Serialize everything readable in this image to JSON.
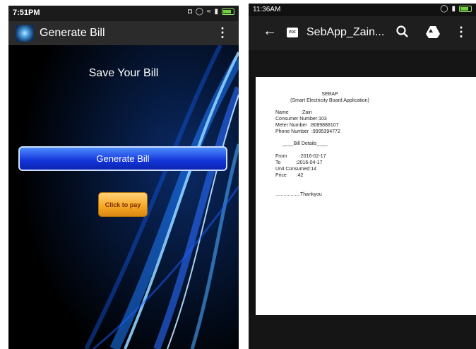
{
  "left": {
    "status_time": "7:51PM",
    "app_title": "Generate Bill",
    "heading": "Save Your Bill",
    "generate_button": "Generate Bill",
    "pay_button": "Click to pay"
  },
  "right": {
    "status_time": "11:36AM",
    "pdf_badge": "PDF",
    "file_title": "SebApp_Zain...",
    "document": {
      "title": "SEBAP",
      "subtitle": "(Smart Electricity Board Application)",
      "name": "Name         :Zain",
      "consumer": "Consumer Number:103",
      "meter": "Meter Number  :8089888107",
      "phone": "Phone Number  :9995394772",
      "bill_details": "____Bill Details____",
      "from": "From         :2016-02-17",
      "to": "To           :2016-04-17",
      "units": "Unit Consumed:14",
      "price": "Price       :42",
      "thanks": "..................Thankyou"
    }
  },
  "colors": {
    "generate_button": "#1334d8",
    "pay_button": "#f5a623",
    "battery": "#6fd23a"
  }
}
